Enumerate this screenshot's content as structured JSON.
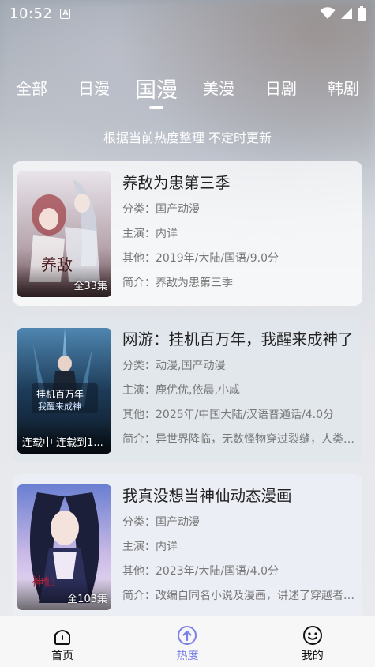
{
  "status_bar": {
    "time": "10:52",
    "badge": "A"
  },
  "tabs": [
    {
      "label": "全部",
      "active": false
    },
    {
      "label": "日漫",
      "active": false
    },
    {
      "label": "国漫",
      "active": true
    },
    {
      "label": "美漫",
      "active": false
    },
    {
      "label": "日剧",
      "active": false
    },
    {
      "label": "韩剧",
      "active": false
    }
  ],
  "subtitle": "根据当前热度整理 不定时更新",
  "items": [
    {
      "title": "养敌为患第三季",
      "category": "分类：国产动漫",
      "cast": "主演：内详",
      "other": "其他：2019年/大陆/国语/9.0分",
      "intro": "简介：养敌为患第三季",
      "cover_text": "全33集",
      "cover_colors": [
        "#c9c3c7",
        "#8e6f73"
      ]
    },
    {
      "title": "网游：挂机百万年，我醒来成神了",
      "category": "分类：动漫,国产动漫",
      "cast": "主演：鹿优优,依晨,小咸",
      "other": "其他：2025年/中国大陆/汉语普通话/4.0分",
      "intro": "简介：异世界降临，无数怪物穿过裂缝，人类危在旦夕",
      "cover_text": "连载中 连载到1...",
      "cover_colors": [
        "#2b4a6b",
        "#0f1c2b"
      ]
    },
    {
      "title": "我真没想当神仙动态漫画",
      "category": "分类：国产动漫",
      "cast": "主演：内详",
      "other": "其他：2023年/大陆/国语/4.0分",
      "intro": "简介：改编自同名小说及漫画，讲述了穿越者的故事",
      "cover_text": "全103集",
      "cover_colors": [
        "#3a3f74",
        "#c8b7d9"
      ]
    }
  ],
  "bottom_nav": [
    {
      "label": "首页",
      "icon": "home-icon",
      "active": false
    },
    {
      "label": "热度",
      "icon": "hot-icon",
      "active": true
    },
    {
      "label": "我的",
      "icon": "smile-icon",
      "active": false
    }
  ],
  "colors": {
    "accent": "#7b7fe6"
  }
}
